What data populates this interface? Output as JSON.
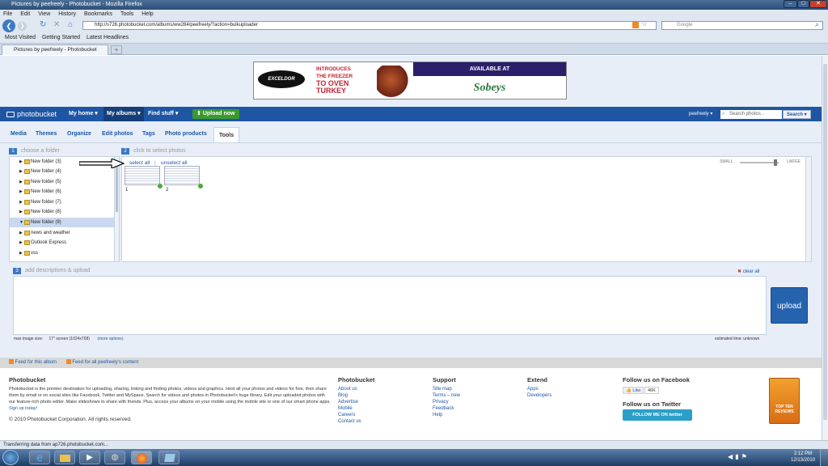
{
  "window": {
    "title": "Pictures by peefreely - Photobucket - Mozilla Firefox"
  },
  "menu": [
    "File",
    "Edit",
    "View",
    "History",
    "Bookmarks",
    "Tools",
    "Help"
  ],
  "nav": {
    "url": "http://s726.photobucket.com/albums/ww284/peefreely/?action=bulkuploader",
    "search_placeholder": "Google"
  },
  "bookmarks": [
    "Most Visited",
    "Getting Started",
    "Latest Headlines"
  ],
  "tab": {
    "label": "Pictures by peefreely - Photobucket"
  },
  "ad": {
    "brand": "EXCELDOR",
    "line1": "INTRODUCES",
    "line2": "THE FREEZER",
    "line3": "TO OVEN",
    "line4": "TURKEY",
    "available": "AVAILABLE AT",
    "store": "Sobeys"
  },
  "pb_nav": {
    "logo": "photobucket",
    "my_home": "My home ▾",
    "my_albums": "My albums ▾",
    "find_stuff": "Find stuff ▾",
    "upload_now": "Upload now",
    "user": "peefreely ▾",
    "search_placeholder": "Search photos...",
    "search_button": "Search ▾"
  },
  "subnav": [
    "Media",
    "Themes",
    "Organize",
    "Edit photos",
    "Tags",
    "Photo products",
    "Tools"
  ],
  "steps": {
    "s1_num": "1",
    "s1_label": "choose a folder",
    "s2_num": "2",
    "s2_label": "click to select photos",
    "s3_num": "3",
    "s3_label": "add descriptions & upload"
  },
  "folders": [
    "New folder (3)",
    "New folder (4)",
    "New folder (5)",
    "New folder (6)",
    "New folder (7)",
    "New folder (8)",
    "New folder (9)",
    "news and weather",
    "Outlook Express",
    "vss"
  ],
  "photos": {
    "select_all": "select all",
    "separator": "|",
    "unselect_all": "unselect all",
    "small": "SMALL",
    "large": "LARGE",
    "thumb1_num": "1",
    "thumb2_num": "2"
  },
  "upload": {
    "clear_all": "clear all",
    "button": "upload",
    "max_size": "max image size:",
    "max_value": "17\" screen (1024x768)",
    "more_options": "(more options)",
    "estimated": "estimated time: unknown"
  },
  "feeds": {
    "album": "Feed for this album",
    "all": "Feed for all peefreely's content"
  },
  "footer": {
    "brand_heading": "Photobucket",
    "about_text": "Photobucket is the premier destination for uploading, sharing, linking and finding photos, videos and graphics. Host all your photos and videos for free, then share them by email or on social sites like Facebook, Twitter and MySpace. Search for videos and photos in Photobucket's huge library. Edit your uploaded photos with our feature-rich photo editor. Make slideshows to share with friends. Plus, access your albums on your mobile using the mobile site or one of our smart phone apps.",
    "signup": "Sign up today!",
    "copyright": "© 2010 Photobucket Corporation. All rights reserved.",
    "col_pb_heading": "Photobucket",
    "col_pb": [
      "About us",
      "Blog",
      "Advertise",
      "Mobile",
      "Careers",
      "Contact us"
    ],
    "col_support_heading": "Support",
    "col_support": [
      "Site map",
      "Terms – new",
      "Privacy",
      "Feedback",
      "Help"
    ],
    "col_extend_heading": "Extend",
    "col_extend": [
      "Apps",
      "Developers"
    ],
    "fb_heading": "Follow us on Facebook",
    "fb_like": "Like",
    "fb_count": "46K",
    "tw_heading": "Follow us on Twitter",
    "tw_button": "FOLLOW ME ON twitter",
    "award": "TOP TEN REVIEWS"
  },
  "status": {
    "text": "Transferring data from ap726.photobucket.com..."
  },
  "clock": {
    "time": "2:12 PM",
    "date": "12/13/2010"
  }
}
